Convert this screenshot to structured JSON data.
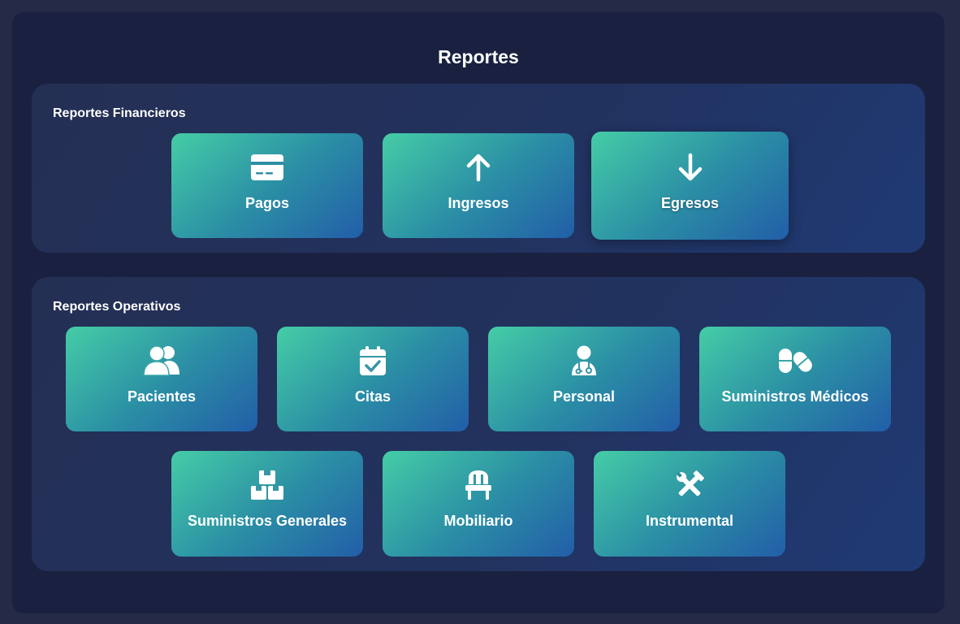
{
  "page": {
    "title": "Reportes"
  },
  "financial": {
    "title": "Reportes Financieros",
    "cards": [
      {
        "label": "Pagos",
        "icon": "credit-card-icon"
      },
      {
        "label": "Ingresos",
        "icon": "arrow-up-icon"
      },
      {
        "label": "Egresos",
        "icon": "arrow-down-icon"
      }
    ]
  },
  "operational": {
    "title": "Reportes Operativos",
    "cards": [
      {
        "label": "Pacientes",
        "icon": "users-icon"
      },
      {
        "label": "Citas",
        "icon": "calendar-check-icon"
      },
      {
        "label": "Personal",
        "icon": "doctor-icon"
      },
      {
        "label": "Suministros Médicos",
        "icon": "pills-icon"
      },
      {
        "label": "Suministros Generales",
        "icon": "boxes-icon"
      },
      {
        "label": "Mobiliario",
        "icon": "chair-icon"
      },
      {
        "label": "Instrumental",
        "icon": "tools-icon"
      }
    ]
  },
  "colors": {
    "background": "#252b47",
    "panel": "#1a2140",
    "card_gradient_start": "#45cda6",
    "card_gradient_end": "#225ea8",
    "text": "#ffffff"
  }
}
